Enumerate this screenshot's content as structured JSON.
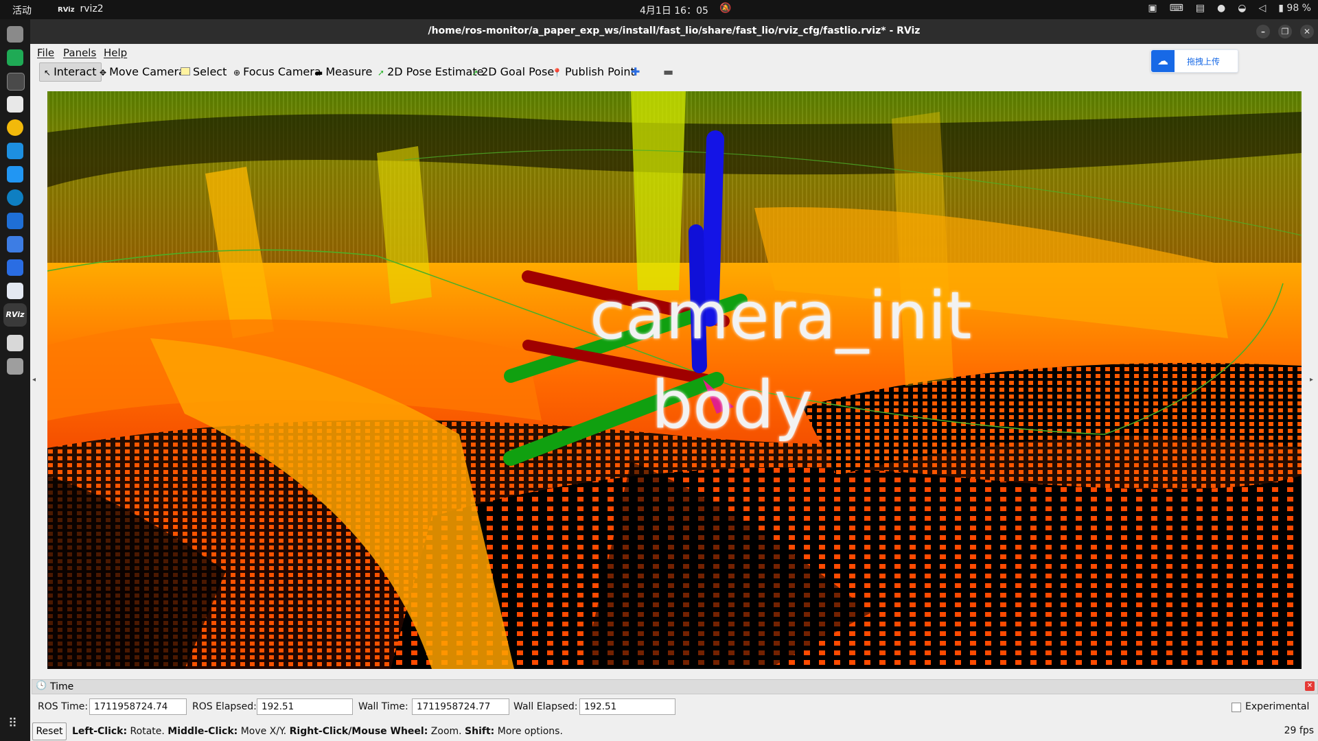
{
  "topbar": {
    "activities": "活动",
    "app_logo": "RViz",
    "app_name": "rviz2",
    "clock": "4月1日 16：05",
    "battery": "98 %"
  },
  "window": {
    "title": "/home/ros-monitor/a_paper_exp_ws/install/fast_lio/share/fast_lio/rviz_cfg/fastlio.rviz* - RViz"
  },
  "menu": {
    "file": "File",
    "panels": "Panels",
    "help": "Help"
  },
  "toolbar": {
    "interact": "Interact",
    "move_camera": "Move Camera",
    "select": "Select",
    "focus_camera": "Focus Camera",
    "measure": "Measure",
    "pose_estimate": "2D Pose Estimate",
    "goal_pose": "2D Goal Pose",
    "publish_point": "Publish Point"
  },
  "upload_widget": {
    "label": "拖拽上传"
  },
  "viewport": {
    "frame_labels": [
      "camera_init",
      "body"
    ],
    "axis_colors": {
      "x": "#c00000",
      "y": "#00b000",
      "z": "#0000ee"
    }
  },
  "time_panel": {
    "title": "Time",
    "ros_time_label": "ROS Time:",
    "ros_time": "1711958724.74",
    "ros_elapsed_label": "ROS Elapsed:",
    "ros_elapsed": "192.51",
    "wall_time_label": "Wall Time:",
    "wall_time": "1711958724.77",
    "wall_elapsed_label": "Wall Elapsed:",
    "wall_elapsed": "192.51",
    "experimental_label": "Experimental"
  },
  "status": {
    "reset": "Reset",
    "left_click": "Left-Click:",
    "left_click_desc": "Rotate.",
    "middle_click": "Middle-Click:",
    "middle_click_desc": "Move X/Y.",
    "right_click": "Right-Click/Mouse Wheel:",
    "right_click_desc": "Zoom.",
    "shift": "Shift:",
    "shift_desc": "More options.",
    "fps": "29 fps"
  }
}
